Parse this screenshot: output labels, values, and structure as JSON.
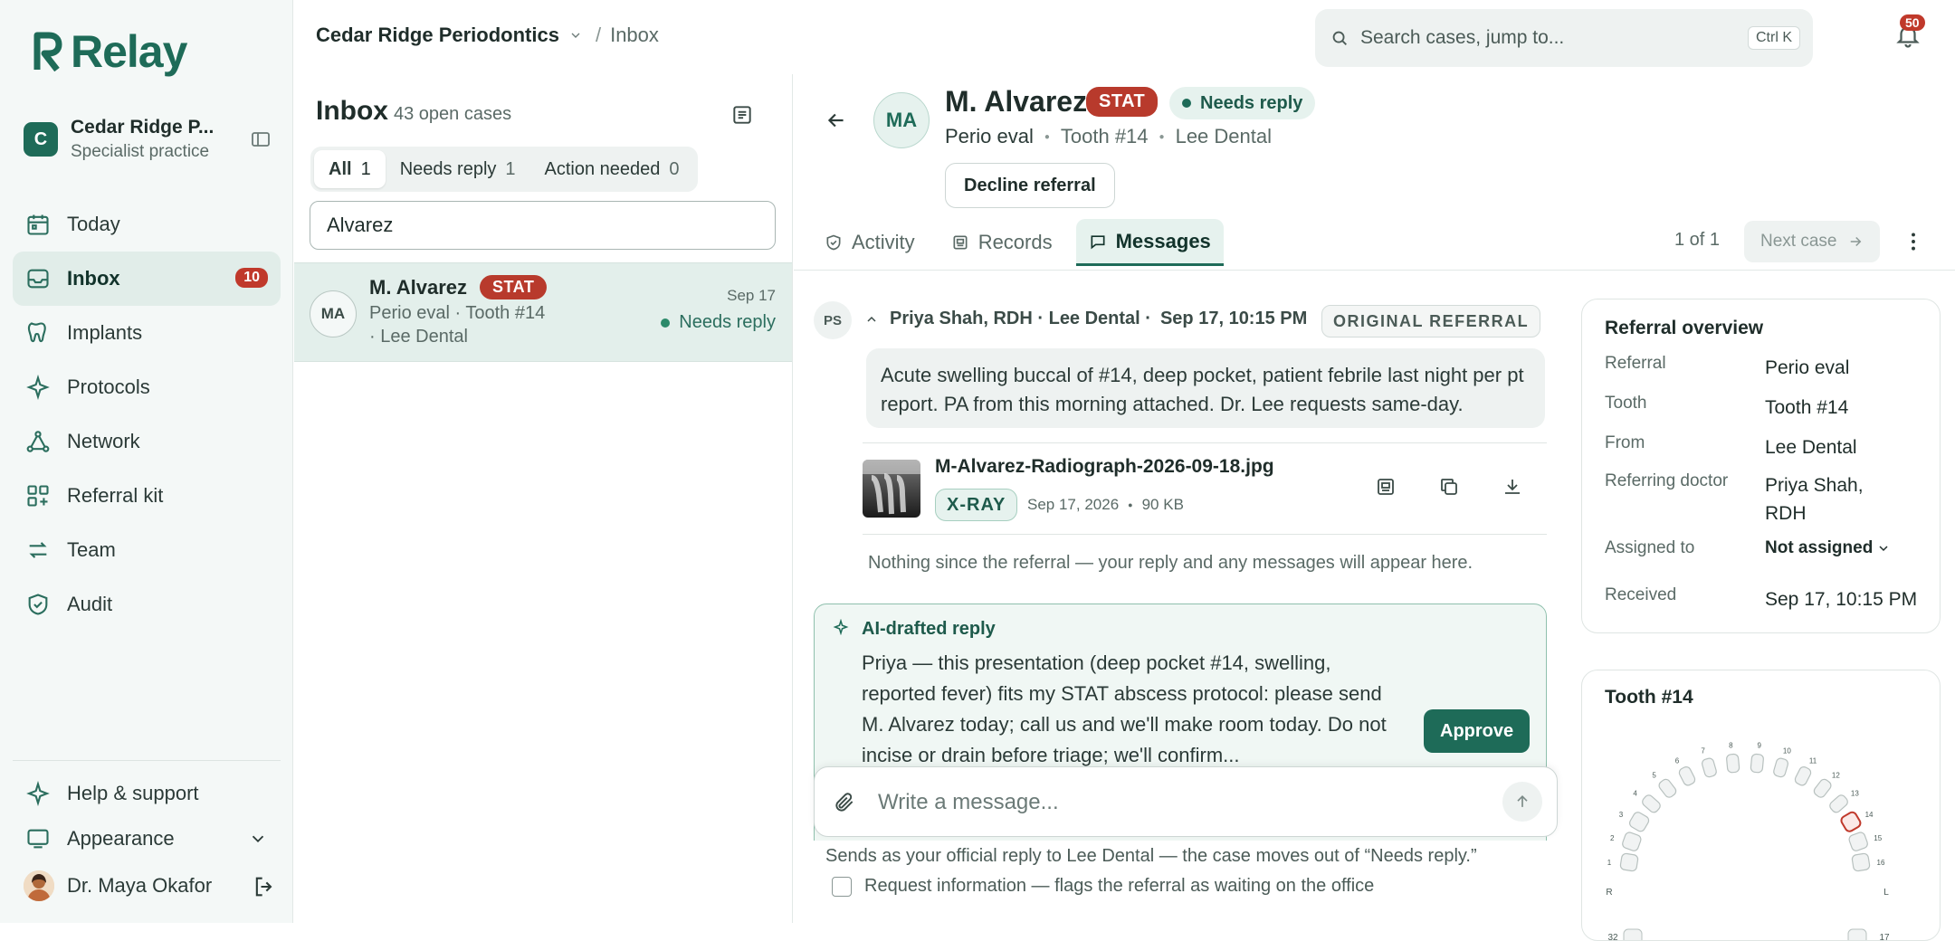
{
  "app": {
    "name": "Relay"
  },
  "org": {
    "initial": "C",
    "name": "Cedar Ridge P...",
    "subtitle": "Specialist practice"
  },
  "nav": [
    {
      "label": "Today",
      "icon": "calendar-icon"
    },
    {
      "label": "Inbox",
      "icon": "inbox-icon",
      "badge": "10",
      "active": true
    },
    {
      "label": "Implants",
      "icon": "tooth-icon"
    },
    {
      "label": "Protocols",
      "icon": "sparkle-icon"
    },
    {
      "label": "Network",
      "icon": "network-icon"
    },
    {
      "label": "Referral kit",
      "icon": "grid-icon"
    },
    {
      "label": "Team",
      "icon": "arrows-icon"
    },
    {
      "label": "Audit",
      "icon": "shield-icon"
    }
  ],
  "sidebar_bottom": {
    "help": "Help & support",
    "appearance": "Appearance",
    "user": "Dr. Maya Okafor"
  },
  "breadcrumb": {
    "org": "Cedar Ridge Periodontics",
    "sep": "/",
    "current": "Inbox"
  },
  "search": {
    "placeholder": "Search cases, jump to...",
    "shortcut": "Ctrl K"
  },
  "notifications": {
    "count": "50"
  },
  "inbox": {
    "title": "Inbox",
    "count": "43 open cases",
    "filters": [
      {
        "label": "All",
        "count": "1",
        "active": true
      },
      {
        "label": "Needs reply",
        "count": "1"
      },
      {
        "label": "Action needed",
        "count": "0"
      }
    ],
    "search_value": "Alvarez",
    "cases": [
      {
        "initials": "MA",
        "name": "M. Alvarez",
        "tag": "STAT",
        "line1": "Perio eval · Tooth #14",
        "line2": "· Lee Dental",
        "date": "Sep 17",
        "status": "Needs reply"
      }
    ]
  },
  "case": {
    "initials": "MA",
    "name": "M. Alvarez",
    "tag": "STAT",
    "status": "Needs reply",
    "type": "Perio eval",
    "tooth": "Tooth #14",
    "from": "Lee Dental",
    "decline_label": "Decline referral",
    "tabs": [
      {
        "label": "Activity",
        "icon": "activity-icon"
      },
      {
        "label": "Records",
        "icon": "records-icon"
      },
      {
        "label": "Messages",
        "icon": "message-icon",
        "active": true
      }
    ],
    "pager": "1 of 1",
    "next_label": "Next case"
  },
  "message": {
    "initials": "PS",
    "author": "Priya Shah, RDH · Lee Dental ·",
    "time": "Sep 17, 10:15 PM",
    "badge": "ORIGINAL REFERRAL",
    "body": "Acute swelling buccal of #14, deep pocket, patient febrile last night per pt report. PA from this morning attached. Dr. Lee requests same-day.",
    "attachment": {
      "name": "M-Alvarez-Radiograph-2026-09-18.jpg",
      "tag": "X-RAY",
      "date": "Sep 17, 2026",
      "size": "90 KB"
    },
    "empty_note": "Nothing since the referral — your reply and any messages will appear here."
  },
  "ai_reply": {
    "title": "AI-drafted reply",
    "body": "Priya — this presentation (deep pocket #14, swelling, reported fever) fits my STAT abscess protocol: please send M. Alvarez today; call us and we'll make room today. Do not incise or drain before triage; we'll confirm...",
    "approve_label": "Approve"
  },
  "composer": {
    "placeholder": "Write a message...",
    "note": "Sends as your official reply to Lee Dental — the case moves out of “Needs reply.”",
    "checkbox_label": "Request information — flags the referral as waiting on the office"
  },
  "overview": {
    "title": "Referral overview",
    "rows": [
      {
        "label": "Referral",
        "value": "Perio eval"
      },
      {
        "label": "Tooth",
        "value": "Tooth #14"
      },
      {
        "label": "From",
        "value": "Lee Dental"
      },
      {
        "label": "Referring doctor",
        "value": "Priya Shah, RDH"
      },
      {
        "label": "Assigned to",
        "value": "Not assigned"
      },
      {
        "label": "Received",
        "value": "Sep 17, 10:15 PM"
      }
    ]
  },
  "tooth_chart": {
    "title": "Tooth #14",
    "selected": 14,
    "left_label": "R",
    "right_label": "L",
    "numbers": [
      "1",
      "2",
      "3",
      "4",
      "5",
      "6",
      "7",
      "8",
      "9",
      "10",
      "11",
      "12",
      "13",
      "14",
      "15",
      "16"
    ],
    "lower_numbers": [
      "32",
      "17"
    ],
    "accent": "#c0392b"
  },
  "colors": {
    "brand": "#1e6b58",
    "stat": "#b83a2c",
    "badge": "#c0392b"
  }
}
